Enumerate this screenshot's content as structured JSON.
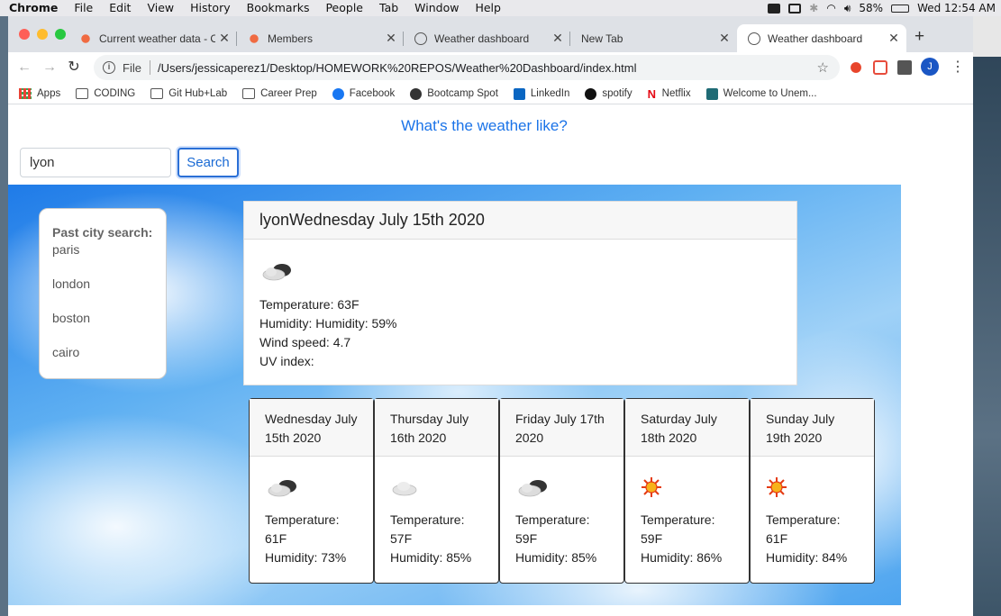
{
  "menubar": {
    "app": "Chrome",
    "items": [
      "File",
      "Edit",
      "View",
      "History",
      "Bookmarks",
      "People",
      "Tab",
      "Window",
      "Help"
    ],
    "battery": "58%",
    "clock": "Wed 12:54 AM"
  },
  "tabs": [
    {
      "label": "Current weather data - Op",
      "icon": "openweather-icon",
      "active": false
    },
    {
      "label": "Members",
      "icon": "openweather-icon",
      "active": false
    },
    {
      "label": "Weather dashboard",
      "icon": "globe-icon",
      "active": false
    },
    {
      "label": "New Tab",
      "icon": "",
      "active": false
    },
    {
      "label": "Weather dashboard",
      "icon": "globe-icon",
      "active": true
    }
  ],
  "omnibox": {
    "scheme_label": "File",
    "url": "/Users/jessicaperez1/Desktop/HOMEWORK%20REPOS/Weather%20Dashboard/index.html"
  },
  "profile_initial": "J",
  "bookmarks": [
    {
      "label": "Apps",
      "icon": "apps-grid-icon"
    },
    {
      "label": "CODING",
      "icon": "folder-icon"
    },
    {
      "label": "Git Hub+Lab",
      "icon": "folder-icon"
    },
    {
      "label": "Career Prep",
      "icon": "folder-icon"
    },
    {
      "label": "Facebook",
      "icon": "facebook-icon"
    },
    {
      "label": "Bootcamp Spot",
      "icon": "globe-icon"
    },
    {
      "label": "LinkedIn",
      "icon": "linkedin-icon"
    },
    {
      "label": "spotify",
      "icon": "spotify-icon"
    },
    {
      "label": "Netflix",
      "icon": "netflix-icon"
    },
    {
      "label": "Welcome to Unem...",
      "icon": "unemployment-icon"
    }
  ],
  "page": {
    "title": "What's the weather like?",
    "search_value": "lyon",
    "search_button": "Search",
    "history_heading": "Past city search:",
    "history": [
      "paris",
      "london",
      "boston",
      "cairo"
    ],
    "today": {
      "header": "lyonWednesday July 15th 2020",
      "icon": "cloud-icon",
      "temperature": "Temperature: 63F",
      "humidity": "Humidity: Humidity: 59%",
      "wind": "Wind speed: 4.7",
      "uv": "UV index:"
    },
    "forecast": [
      {
        "date": "Wednesday July 15th 2020",
        "icon": "cloud-icon",
        "temp": "Temperature: 61F",
        "humidity": "Humidity: 73%"
      },
      {
        "date": "Thursday July 16th 2020",
        "icon": "light-cloud-icon",
        "temp": "Temperature: 57F",
        "humidity": "Humidity: 85%"
      },
      {
        "date": "Friday July 17th 2020",
        "icon": "cloud-icon",
        "temp": "Temperature: 59F",
        "humidity": "Humidity: 85%"
      },
      {
        "date": "Saturday July 18th 2020",
        "icon": "sun-icon",
        "temp": "Temperature: 59F",
        "humidity": "Humidity: 86%"
      },
      {
        "date": "Sunday July 19th 2020",
        "icon": "sun-icon",
        "temp": "Temperature: 61F",
        "humidity": "Humidity: 84%"
      }
    ]
  }
}
